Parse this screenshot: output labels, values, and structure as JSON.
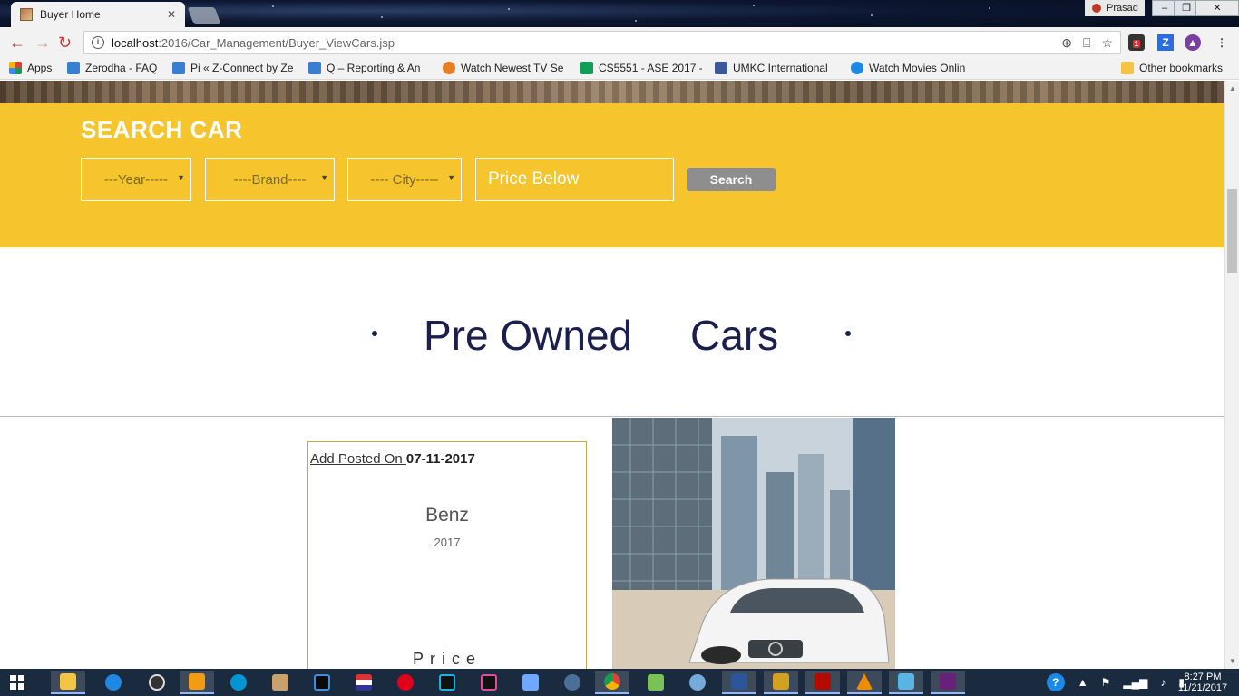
{
  "browser": {
    "tab_title": "Buyer Home",
    "profile_name": "Prasad",
    "url_host": "localhost",
    "url_path": ":2016/Car_Management/Buyer_ViewCars.jsp",
    "extension_badge": "1"
  },
  "bookmarks": [
    {
      "label": "Apps",
      "icon_color": "#e33e2b"
    },
    {
      "label": "Zerodha - FAQ",
      "icon_color": "#387ed1"
    },
    {
      "label": "Pi « Z-Connect by Ze",
      "icon_color": "#387ed1"
    },
    {
      "label": "Q – Reporting & An",
      "icon_color": "#387ed1"
    },
    {
      "label": "Watch Newest TV Se",
      "icon_color": "#e67e22"
    },
    {
      "label": "CS5551 - ASE 2017 -",
      "icon_color": "#0f9d58"
    },
    {
      "label": "UMKC International",
      "icon_color": "#3b5998"
    },
    {
      "label": "Watch Movies Onlin",
      "icon_color": "#1e88e5"
    },
    {
      "label": "Other bookmarks",
      "icon_color": "#f4c542"
    }
  ],
  "search": {
    "title": "SEARCH CAR",
    "year_select": "---Year-----",
    "brand_select": "----Brand----",
    "city_select": "---- City-----",
    "price_placeholder": "Price Below",
    "button_label": "Search"
  },
  "section": {
    "heading": "Pre Owned     Cars"
  },
  "listing": {
    "posted_label": "Add Posted On ",
    "posted_date": "07-11-2017",
    "brand": "Benz",
    "year": "2017",
    "price_label": "Price"
  },
  "taskbar": {
    "time": "8:27 PM",
    "date": "11/21/2017"
  },
  "colors": {
    "search_panel": "#f6c42c",
    "heading": "#1a1f4d",
    "card_border": "#caa64a",
    "taskbar": "#1b2b3f"
  }
}
